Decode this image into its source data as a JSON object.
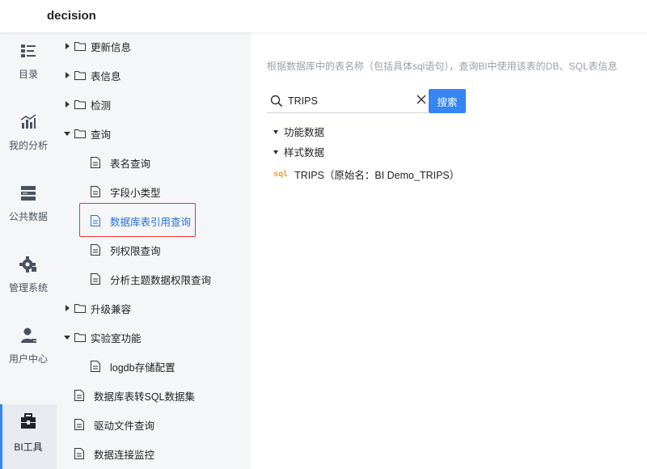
{
  "app": {
    "title": "decision"
  },
  "leftnav": {
    "items": [
      {
        "label": "目录",
        "icon": "catalog-icon"
      },
      {
        "label": "我的分析",
        "icon": "analysis-chart-icon"
      },
      {
        "label": "公共数据",
        "icon": "database-icon"
      },
      {
        "label": "管理系统",
        "icon": "gear-icon"
      },
      {
        "label": "用户中心",
        "icon": "user-icon"
      },
      {
        "label": "BI工具",
        "icon": "toolbox-icon",
        "active": true
      }
    ]
  },
  "tree": {
    "nodes": [
      {
        "label": "更新信息",
        "type": "folder",
        "expanded": false
      },
      {
        "label": "表信息",
        "type": "folder",
        "expanded": false
      },
      {
        "label": "检测",
        "type": "folder",
        "expanded": false
      },
      {
        "label": "查询",
        "type": "folder",
        "expanded": true
      },
      {
        "label": "表名查询",
        "type": "doc"
      },
      {
        "label": "字段小类型",
        "type": "doc"
      },
      {
        "label": "数据库表引用查询",
        "type": "doc",
        "selected": true
      },
      {
        "label": "列权限查询",
        "type": "doc"
      },
      {
        "label": "分析主题数据权限查询",
        "type": "doc"
      },
      {
        "label": "升级兼容",
        "type": "folder",
        "expanded": false
      },
      {
        "label": "实验室功能",
        "type": "folder",
        "expanded": true
      },
      {
        "label": "logdb存储配置",
        "type": "doc"
      },
      {
        "label": "数据库表转SQL数据集",
        "type": "doc"
      },
      {
        "label": "驱动文件查询",
        "type": "doc"
      },
      {
        "label": "数据连接监控",
        "type": "doc"
      }
    ]
  },
  "main": {
    "description": "根据数据库中的表名称（包括具体sql语句），查询BI中使用该表的DB、SQL表信息",
    "search": {
      "value": "TRIPS",
      "button_label": "搜索"
    },
    "results": {
      "groups": [
        "功能数据",
        "样式数据"
      ],
      "sql_tag": "sql",
      "sql_item": "TRIPS（原始名：BI Demo_TRIPS）"
    }
  },
  "colors": {
    "accent": "#3685f2",
    "highlight_border": "#e03a3a",
    "sql_tag": "#f0a032",
    "nav_bg": "#f5f6f7"
  }
}
